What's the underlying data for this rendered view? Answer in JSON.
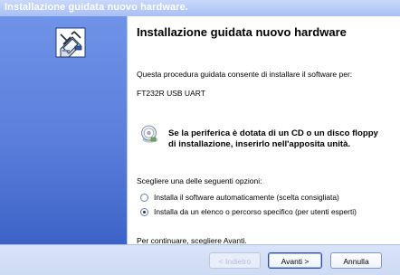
{
  "window": {
    "title": "Installazione guidata nuovo hardware."
  },
  "wizard": {
    "heading": "Installazione guidata nuovo hardware",
    "intro": "Questa procedura guidata consente di installare il software per:",
    "device_name": "FT232R USB UART",
    "cd_notice_line1": "Se la periferica è dotata di un CD o un disco floppy",
    "cd_notice_line2": "di installazione, inserirlo nell'apposita unità.",
    "options_label": "Scegliere una delle seguenti opzioni:",
    "options": [
      {
        "label": "Installa il software automaticamente (scelta consigliata)",
        "selected": false
      },
      {
        "label": "Installa da un elenco o percorso specifico (per utenti esperti)",
        "selected": true
      }
    ],
    "continue_hint": "Per continuare, scegliere Avanti."
  },
  "buttons": {
    "back_label": "< Indietro",
    "next_label": "Avanti >",
    "cancel_label": "Annulla"
  },
  "icons": {
    "wizard_banner_icon": "hardware-wizard-icon",
    "cd_icon": "cd-icon"
  },
  "colors": {
    "banner_top": "#6f93e8",
    "banner_bottom": "#3c63c8",
    "footer_bg": "#d9e3f8",
    "title_bar": "#b8cbf7"
  }
}
